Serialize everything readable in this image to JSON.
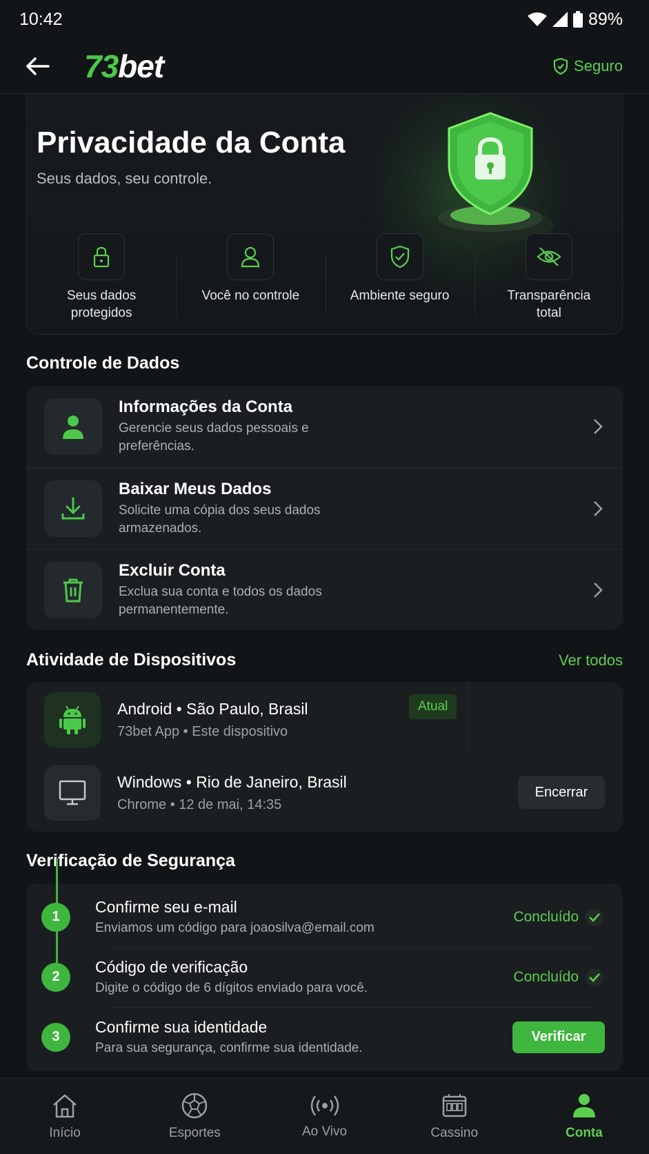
{
  "status_bar": {
    "time": "10:42",
    "battery": "89%"
  },
  "header": {
    "logo_prefix": "73",
    "logo_suffix": "bet",
    "secure_label": "Seguro"
  },
  "hero": {
    "title": "Privacidade da Conta",
    "subtitle": "Seus dados, seu controle.",
    "features": [
      {
        "icon": "lock-icon",
        "label": "Seus dados protegidos"
      },
      {
        "icon": "user-icon",
        "label": "Você no controle"
      },
      {
        "icon": "shield-check-icon",
        "label": "Ambiente seguro"
      },
      {
        "icon": "eye-off-icon",
        "label": "Transparência total"
      }
    ]
  },
  "data_control": {
    "title": "Controle de Dados",
    "items": [
      {
        "icon": "user-icon",
        "title": "Informações da Conta",
        "desc": "Gerencie seus dados pessoais e preferências."
      },
      {
        "icon": "download-icon",
        "title": "Baixar Meus Dados",
        "desc": "Solicite uma cópia dos seus dados armazenados."
      },
      {
        "icon": "trash-icon",
        "title": "Excluir Conta",
        "desc": "Exclua sua conta e todos os dados permanentemente."
      }
    ]
  },
  "devices": {
    "title": "Atividade de Dispositivos",
    "see_all": "Ver todos",
    "items": [
      {
        "icon": "android-icon",
        "title": "Android • São Paulo, Brasil",
        "sub": "73bet App • Este dispositivo",
        "badge": "Atual"
      },
      {
        "icon": "monitor-icon",
        "title": "Windows • Rio de Janeiro, Brasil",
        "sub": "Chrome • 12 de mai, 14:35",
        "action": "Encerrar"
      }
    ]
  },
  "security": {
    "title": "Verificação de Segurança",
    "steps": [
      {
        "num": "1",
        "title": "Confirme seu e-mail",
        "desc": "Enviamos um código para joaosilva@email.com",
        "status": "Concluído"
      },
      {
        "num": "2",
        "title": "Código de verificação",
        "desc": "Digite o código de 6 dígitos enviado para você.",
        "status": "Concluído"
      },
      {
        "num": "3",
        "title": "Confirme sua identidade",
        "desc": "Para sua segurança, confirme sua identidade.",
        "action": "Verificar"
      }
    ]
  },
  "bottom_nav": [
    {
      "icon": "home-icon",
      "label": "Início"
    },
    {
      "icon": "soccer-ball-icon",
      "label": "Esportes"
    },
    {
      "icon": "live-broadcast-icon",
      "label": "Ao Vivo"
    },
    {
      "icon": "slot-machine-icon",
      "label": "Cassino"
    },
    {
      "icon": "user-icon",
      "label": "Conta",
      "active": true
    }
  ],
  "colors": {
    "accent": "#4cc94a",
    "background": "#121518",
    "card": "#1a1e21"
  }
}
